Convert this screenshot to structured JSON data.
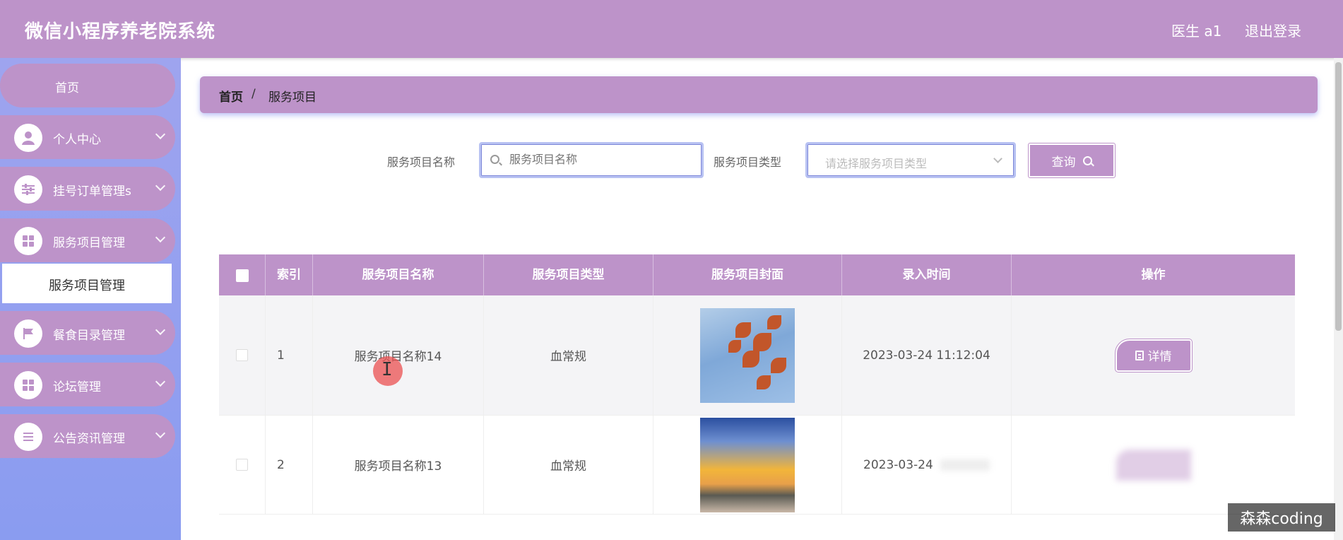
{
  "header": {
    "title": "微信小程序养老院系统",
    "user": "医生 a1",
    "logout": "退出登录"
  },
  "sidebar": {
    "home": "首页",
    "items": [
      {
        "label": "个人中心",
        "icon": "user-icon"
      },
      {
        "label": "挂号订单管理s",
        "icon": "sliders-icon"
      },
      {
        "label": "服务项目管理",
        "icon": "grid-icon"
      },
      {
        "label": "餐食目录管理",
        "icon": "flag-icon"
      },
      {
        "label": "论坛管理",
        "icon": "grid-icon"
      },
      {
        "label": "公告资讯管理",
        "icon": "list-icon"
      }
    ],
    "submenu_active": "服务项目管理"
  },
  "breadcrumb": {
    "home": "首页",
    "sep": "/",
    "current": "服务项目"
  },
  "search": {
    "name_label": "服务项目名称",
    "name_placeholder": "服务项目名称",
    "type_label": "服务项目类型",
    "type_placeholder": "请选择服务项目类型",
    "query_button": "查询"
  },
  "table": {
    "headers": [
      "索引",
      "服务项目名称",
      "服务项目类型",
      "服务项目封面",
      "录入时间",
      "操作"
    ],
    "rows": [
      {
        "index": "1",
        "name": "服务项目名称14",
        "type": "血常规",
        "time": "2023-03-24 11:12:04",
        "action": "详情"
      },
      {
        "index": "2",
        "name": "服务项目名称13",
        "type": "血常规",
        "time": "2023-03-24",
        "action": ""
      }
    ]
  },
  "watermark": "森森coding",
  "colors": {
    "accent": "#bd93c9",
    "sidebar": "#8a9cf0"
  }
}
